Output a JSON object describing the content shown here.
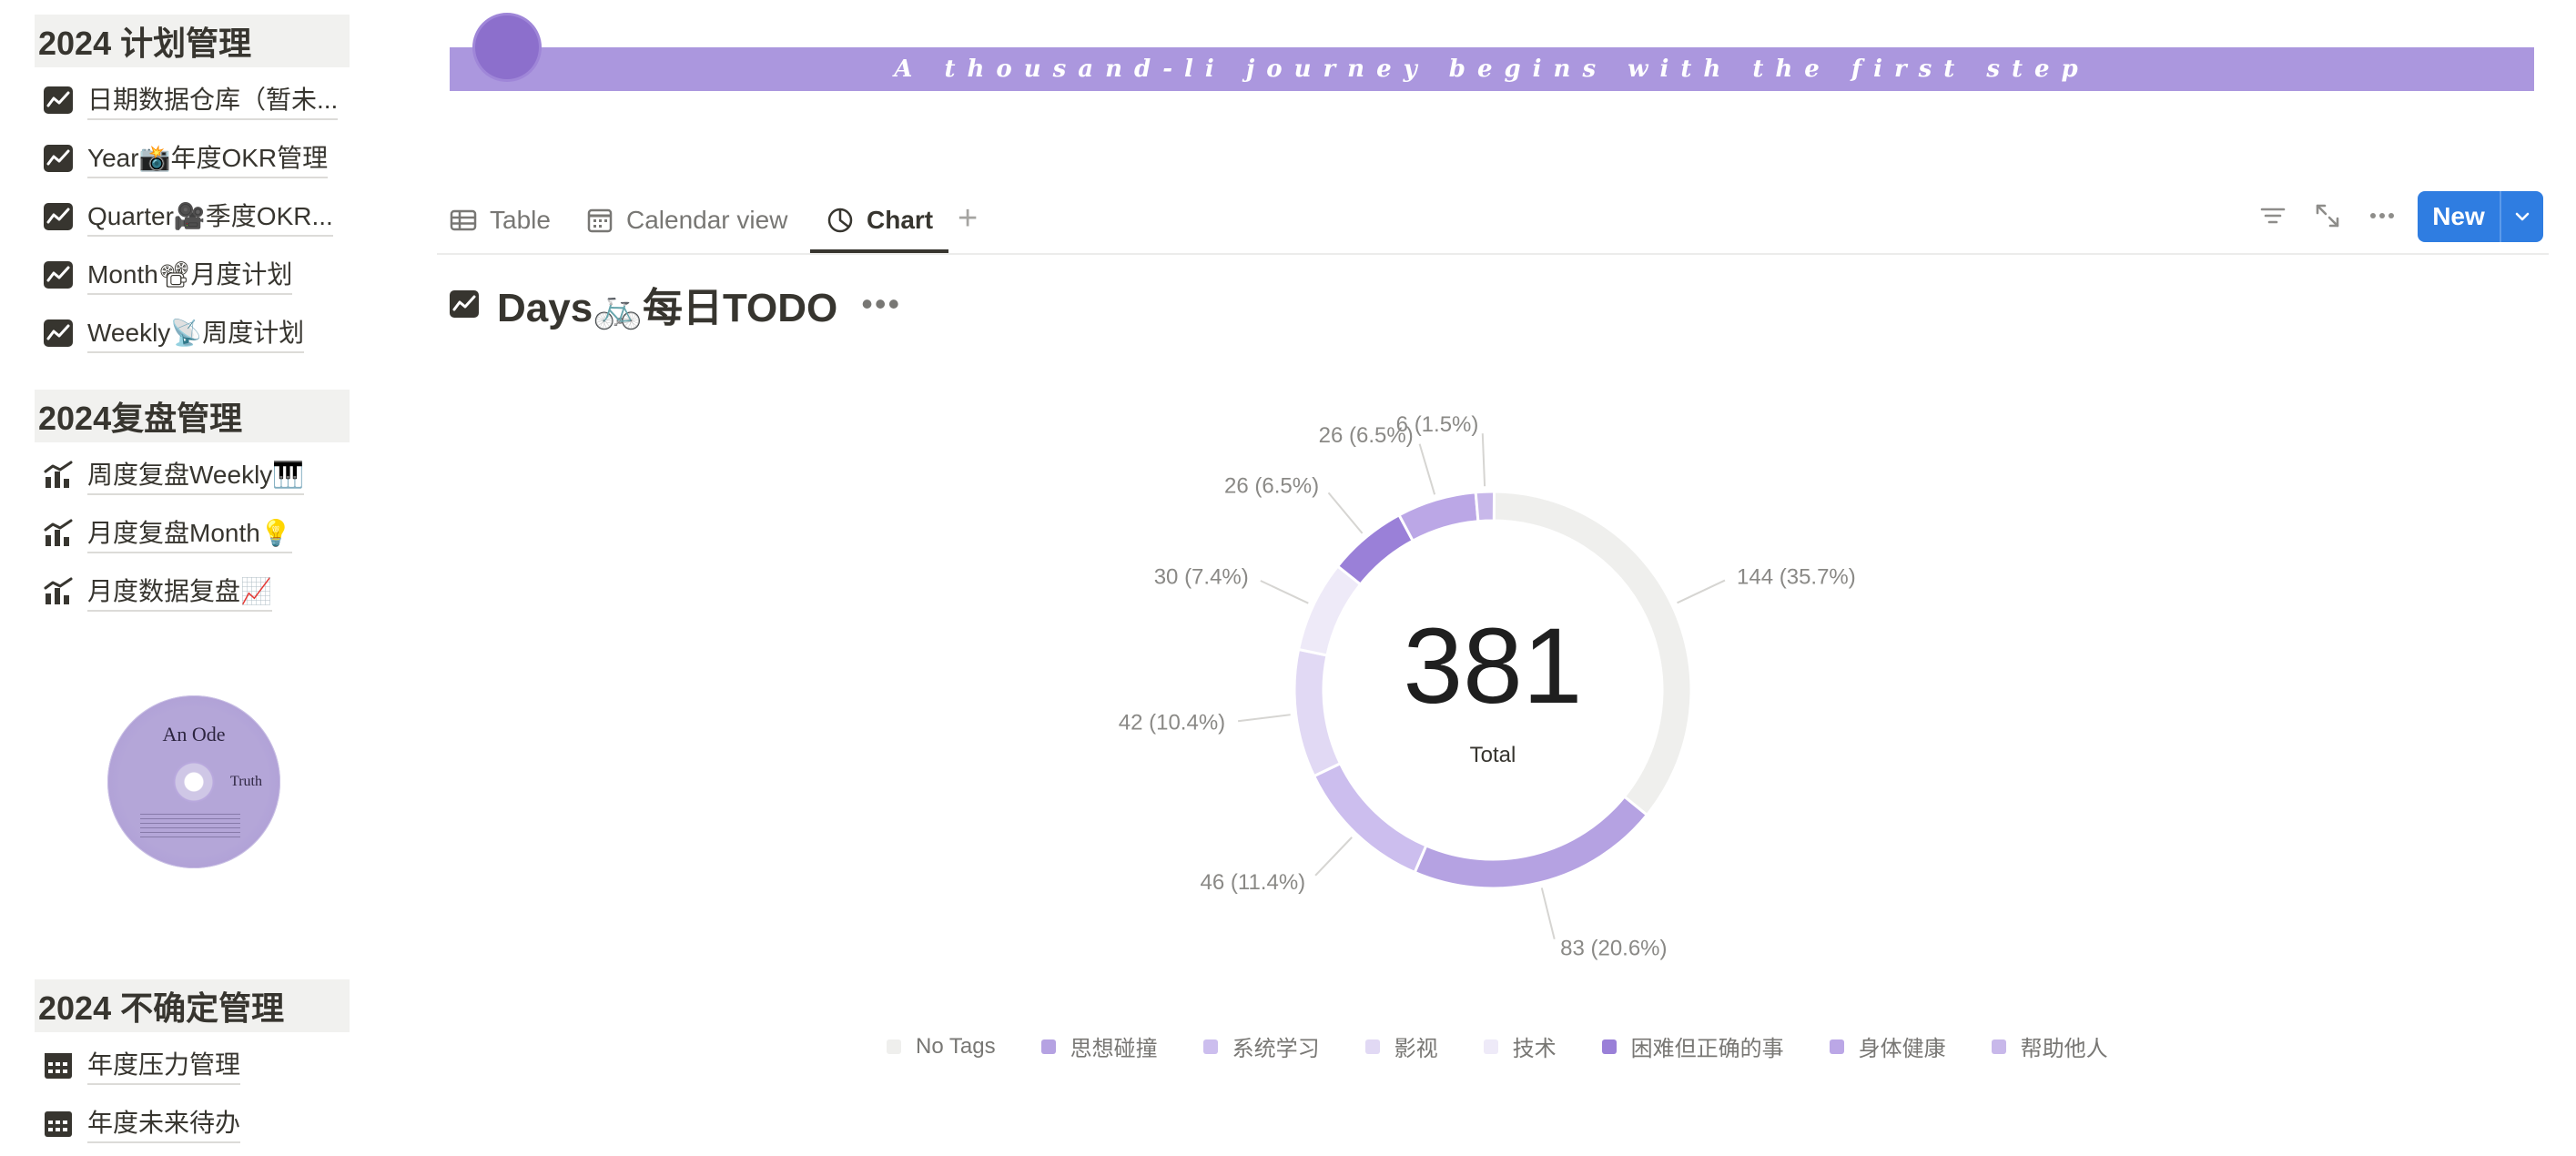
{
  "sidebar": {
    "plan_section": {
      "title": "2024 计划管理",
      "items": [
        {
          "label": "日期数据仓库（暂未..."
        },
        {
          "label": "Year📸年度OKR管理"
        },
        {
          "label": "Quarter🎥季度OKR..."
        },
        {
          "label": "Month📽月度计划"
        },
        {
          "label": "Weekly📡周度计划"
        }
      ]
    },
    "review_section": {
      "title": "2024复盘管理",
      "items": [
        {
          "label": "周度复盘Weekly🎹"
        },
        {
          "label": "月度复盘Month💡"
        },
        {
          "label": "月度数据复盘📈"
        }
      ]
    },
    "disc": {
      "title": "An Ode",
      "subtitle": "Truth"
    },
    "uncertain_section": {
      "title": "2024 不确定管理",
      "items": [
        {
          "label": "年度压力管理"
        },
        {
          "label": "年度未来待办"
        }
      ]
    }
  },
  "banner": {
    "text": "A thousand-li journey begins with the first step",
    "color": "#ab97de"
  },
  "tabs": [
    {
      "label": "Table"
    },
    {
      "label": "Calendar view"
    },
    {
      "label": "Chart"
    }
  ],
  "toolbar": {
    "new_label": "New",
    "accent": "#2f7de1"
  },
  "view": {
    "title": "Days🚲每日TODO"
  },
  "chart_data": {
    "type": "donut",
    "total": 381,
    "total_label": "Total",
    "slices": [
      {
        "name": "No Tags",
        "value": 144,
        "label": "144 (35.7%)",
        "color": "#efefed"
      },
      {
        "name": "思想碰撞",
        "value": 83,
        "label": "83 (20.6%)",
        "color": "#b5a2e2"
      },
      {
        "name": "系统学习",
        "value": 46,
        "label": "46 (11.4%)",
        "color": "#ccbeee"
      },
      {
        "name": "影视",
        "value": 42,
        "label": "42 (10.4%)",
        "color": "#e1d9f4"
      },
      {
        "name": "技术",
        "value": 30,
        "label": "30 (7.4%)",
        "color": "#eeeaf8"
      },
      {
        "name": "困难但正确的事",
        "value": 26,
        "label": "26 (6.5%)",
        "color": "#9a80d8"
      },
      {
        "name": "身体健康",
        "value": 26,
        "label": "26 (6.5%)",
        "color": "#bba7e6"
      },
      {
        "name": "帮助他人",
        "value": 6,
        "label": "6 (1.5%)",
        "color": "#c8b8ea"
      }
    ],
    "legend": [
      "No Tags",
      "思想碰撞",
      "系统学习",
      "影视",
      "技术",
      "困难但正确的事",
      "身体健康",
      "帮助他人"
    ]
  }
}
